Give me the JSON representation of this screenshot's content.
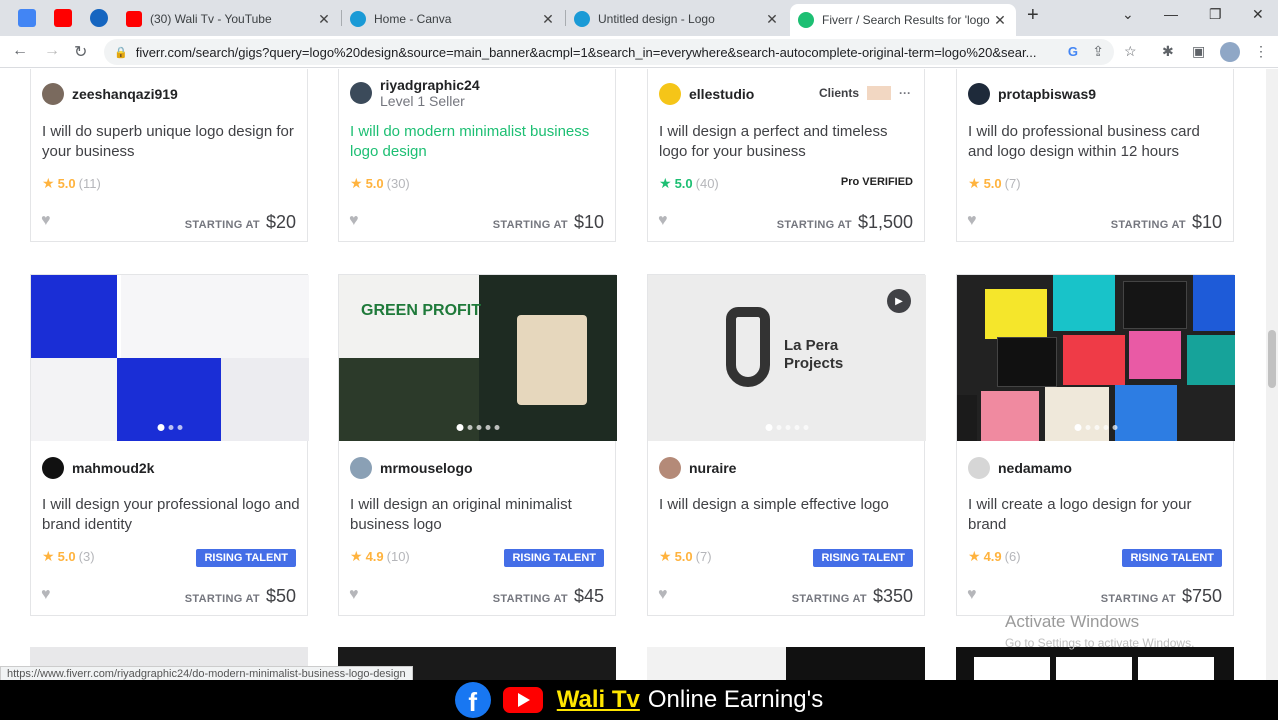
{
  "browser": {
    "tabs": [
      {
        "title": "(30) Wali Tv - YouTube",
        "color": "#ff0000"
      },
      {
        "title": "Home - Canva",
        "color": "#1a9ad6"
      },
      {
        "title": "Untitled design - Logo",
        "color": "#1a9ad6"
      },
      {
        "title": "Fiverr / Search Results for 'logo d",
        "color": "#1dbf73"
      }
    ],
    "new_tab": "+",
    "url": "fiverr.com/search/gigs?query=logo%20design&source=main_banner&acmpl=1&search_in=everywhere&search-autocomplete-original-term=logo%20&sear..."
  },
  "gigs_row1": [
    {
      "seller": "zeeshanqazi919",
      "level": "",
      "title": "I will do superb unique logo design for your business",
      "rating": "5.0",
      "count": "(11)",
      "price": "$20",
      "highlight": false
    },
    {
      "seller": "riyadgraphic24",
      "level": "Level 1 Seller",
      "title": "I will do modern minimalist business logo design",
      "rating": "5.0",
      "count": "(30)",
      "price": "$10",
      "highlight": true
    },
    {
      "seller": "ellestudio",
      "level": "",
      "clients": "Clients",
      "title": "I will design a perfect and timeless logo for your business",
      "rating": "5.0",
      "count": "(40)",
      "price": "$1,500",
      "pro": "Pro VERIFIED",
      "highlight": false
    },
    {
      "seller": "protapbiswas9",
      "level": "",
      "title": "I will do professional business card and logo design within 12 hours",
      "rating": "5.0",
      "count": "(7)",
      "price": "$10",
      "highlight": false
    }
  ],
  "gigs_row2": [
    {
      "seller": "mahmoud2k",
      "title": "I will design your professional logo and brand identity",
      "rating": "5.0",
      "count": "(3)",
      "price": "$50",
      "badge": "RISING TALENT"
    },
    {
      "seller": "mrmouselogo",
      "title": "I will design an original minimalist business logo",
      "rating": "4.9",
      "count": "(10)",
      "price": "$45",
      "badge": "RISING TALENT",
      "thumb_text": "GREEN PROFIT"
    },
    {
      "seller": "nuraire",
      "title": "I will design a simple effective logo",
      "rating": "5.0",
      "count": "(7)",
      "price": "$350",
      "badge": "RISING TALENT",
      "thumb_text": "La Pera Projects"
    },
    {
      "seller": "nedamamo",
      "title": "I will create a logo design for your brand",
      "rating": "4.9",
      "count": "(6)",
      "price": "$750",
      "badge": "RISING TALENT"
    }
  ],
  "starting_at": "STARTING AT",
  "watermark": {
    "line1": "Activate Windows",
    "line2": "Go to Settings to activate Windows."
  },
  "status_url": "https://www.fiverr.com/riyadgraphic24/do-modern-minimalist-business-logo-design",
  "footer": {
    "brand": "Wali Tv",
    "rest": "Online Earning's"
  }
}
